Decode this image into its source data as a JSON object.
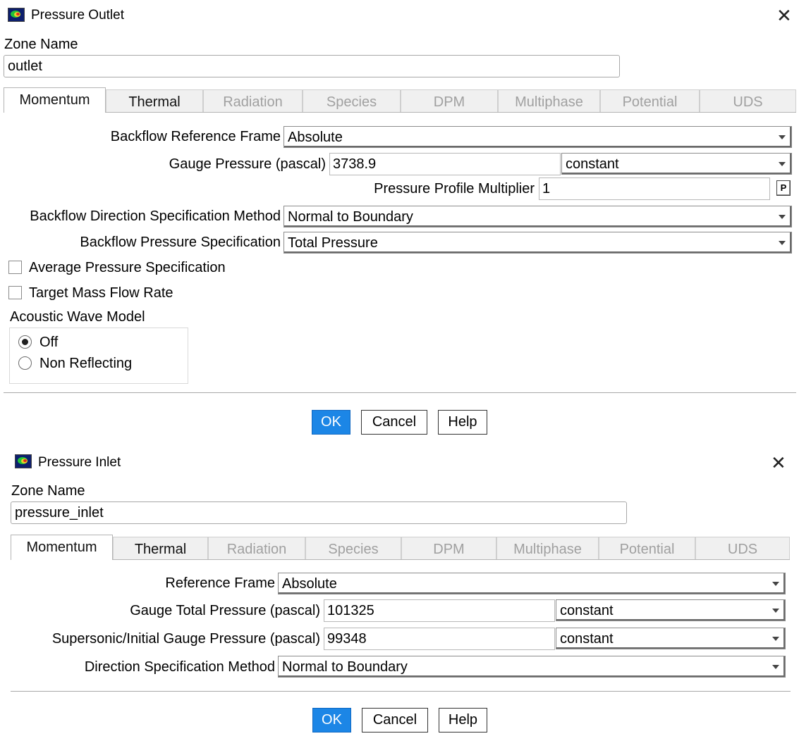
{
  "outlet": {
    "title": "Pressure Outlet",
    "zone_name_label": "Zone Name",
    "zone_name_value": "outlet",
    "tabs": [
      {
        "label": "Momentum",
        "state": "active"
      },
      {
        "label": "Thermal",
        "state": "enabled"
      },
      {
        "label": "Radiation",
        "state": "disabled"
      },
      {
        "label": "Species",
        "state": "disabled"
      },
      {
        "label": "DPM",
        "state": "disabled"
      },
      {
        "label": "Multiphase",
        "state": "disabled"
      },
      {
        "label": "Potential",
        "state": "disabled"
      },
      {
        "label": "UDS",
        "state": "disabled"
      }
    ],
    "backflow_reference_frame": {
      "label": "Backflow Reference Frame",
      "value": "Absolute"
    },
    "gauge_pressure": {
      "label": "Gauge Pressure (pascal)",
      "value": "3738.9",
      "method": "constant"
    },
    "pressure_profile_multiplier": {
      "label": "Pressure Profile Multiplier",
      "value": "1",
      "p_button": "P"
    },
    "backflow_direction_method": {
      "label": "Backflow Direction Specification Method",
      "value": "Normal to Boundary"
    },
    "backflow_pressure_spec": {
      "label": "Backflow Pressure Specification",
      "value": "Total Pressure"
    },
    "average_pressure_spec": {
      "label": "Average Pressure Specification",
      "checked": false
    },
    "target_mass_flow_rate": {
      "label": "Target Mass Flow Rate",
      "checked": false
    },
    "acoustic_wave_model": {
      "label": "Acoustic Wave Model",
      "options": [
        {
          "label": "Off",
          "selected": true
        },
        {
          "label": "Non Reflecting",
          "selected": false
        }
      ]
    },
    "buttons": {
      "ok": "OK",
      "cancel": "Cancel",
      "help": "Help"
    }
  },
  "inlet": {
    "title": "Pressure Inlet",
    "zone_name_label": "Zone Name",
    "zone_name_value": "pressure_inlet",
    "tabs": [
      {
        "label": "Momentum",
        "state": "active"
      },
      {
        "label": "Thermal",
        "state": "enabled"
      },
      {
        "label": "Radiation",
        "state": "disabled"
      },
      {
        "label": "Species",
        "state": "disabled"
      },
      {
        "label": "DPM",
        "state": "disabled"
      },
      {
        "label": "Multiphase",
        "state": "disabled"
      },
      {
        "label": "Potential",
        "state": "disabled"
      },
      {
        "label": "UDS",
        "state": "disabled"
      }
    ],
    "reference_frame": {
      "label": "Reference Frame",
      "value": "Absolute"
    },
    "gauge_total_pressure": {
      "label": "Gauge Total Pressure (pascal)",
      "value": "101325",
      "method": "constant"
    },
    "supersonic_gauge_pressure": {
      "label": "Supersonic/Initial Gauge Pressure (pascal)",
      "value": "99348",
      "method": "constant"
    },
    "direction_spec_method": {
      "label": "Direction Specification Method",
      "value": "Normal to Boundary"
    },
    "buttons": {
      "ok": "OK",
      "cancel": "Cancel",
      "help": "Help"
    }
  },
  "icons": {
    "window_icon": "fluent-app-icon",
    "close": "close-icon",
    "dropdown": "chevron-down-icon"
  }
}
